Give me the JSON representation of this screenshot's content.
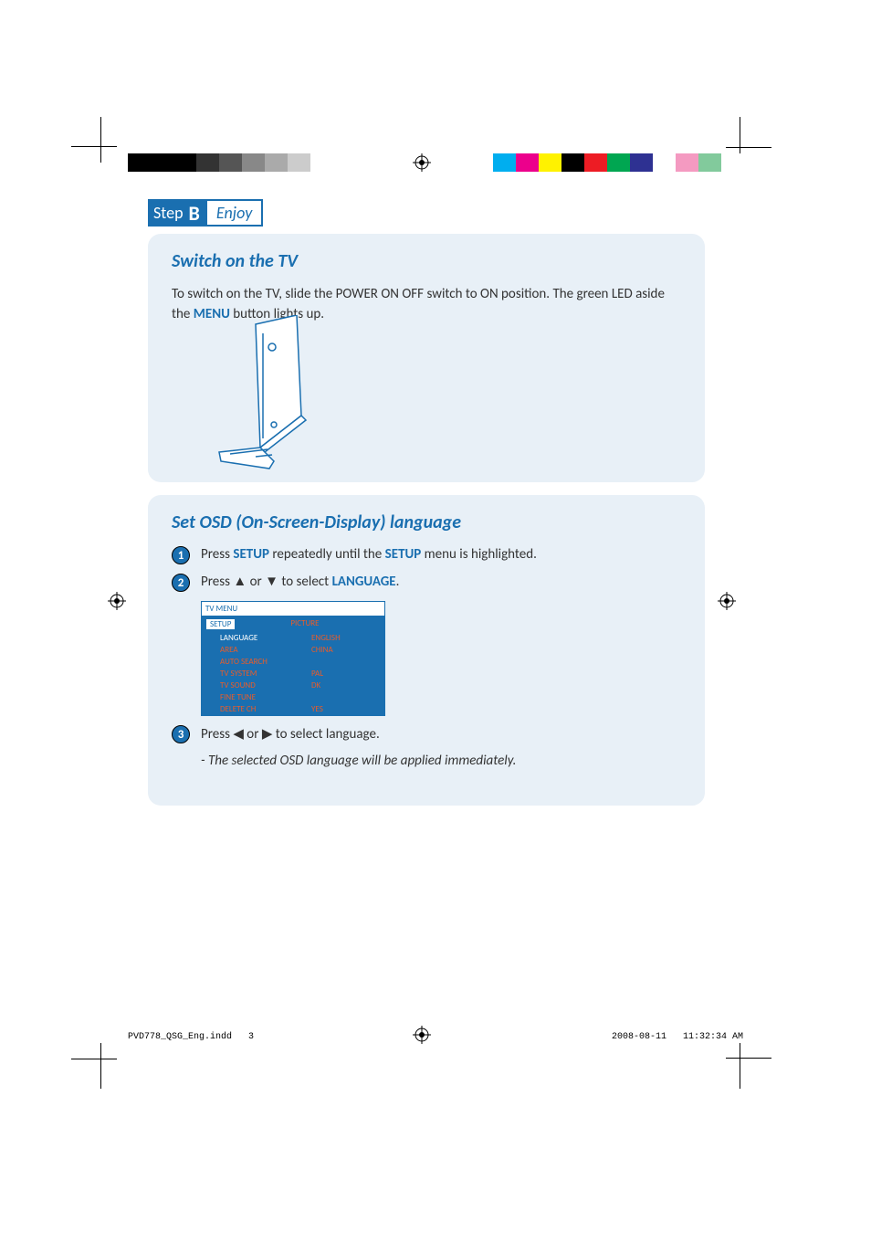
{
  "step_header": {
    "step_label": "Step",
    "step_letter": "B",
    "step_title": "Enjoy"
  },
  "panel1": {
    "heading": "Switch on the TV",
    "body_before": "To switch on the TV, slide the POWER ON OFF switch to ON position.  The green LED aside the ",
    "menu_word": "MENU",
    "body_after": " button lights up."
  },
  "panel2": {
    "heading": "Set OSD (On-Screen-Display) language",
    "steps": [
      {
        "num": "1",
        "pre": "Press ",
        "kw1": "SETUP",
        "mid": " repeatedly until the ",
        "kw2": "SETUP",
        "post": " menu is highlighted."
      },
      {
        "num": "2",
        "pre": "Press ▲ or ▼ to select ",
        "kw1": "LANGUAGE",
        "post": "."
      },
      {
        "num": "3",
        "pre": "Press ◀ or ▶ to select language.",
        "note": "- The selected OSD language will be applied immediately."
      }
    ],
    "tvmenu": {
      "title": "TV MENU",
      "tab_active": "SETUP",
      "tab_inactive": "PICTURE",
      "rows": [
        {
          "k": "LANGUAGE",
          "v": "ENGLISH",
          "sel": true
        },
        {
          "k": "AREA",
          "v": "CHINA"
        },
        {
          "k": "AUTO SEARCH",
          "v": ""
        },
        {
          "k": "TV SYSTEM",
          "v": "PAL"
        },
        {
          "k": "TV SOUND",
          "v": "DK"
        },
        {
          "k": "FINE TUNE",
          "v": ""
        },
        {
          "k": "DELETE CH",
          "v": "YES"
        }
      ]
    }
  },
  "footer": {
    "file": "PVD778_QSG_Eng.indd",
    "page": "3",
    "date": "2008-08-11",
    "time": "11:32:34 AM"
  },
  "colorbars": {
    "left": [
      "#000000",
      "#000000",
      "#000000",
      "#333333",
      "#555555",
      "#888888",
      "#aaaaaa",
      "#cccccc",
      "#ffffff"
    ],
    "right": [
      "#00aeef",
      "#ec008c",
      "#fff200",
      "#000000",
      "#ed1c24",
      "#00a651",
      "#2e3192",
      "#ffffff",
      "#f49ac1",
      "#82ca9c",
      "#ffffff"
    ]
  }
}
